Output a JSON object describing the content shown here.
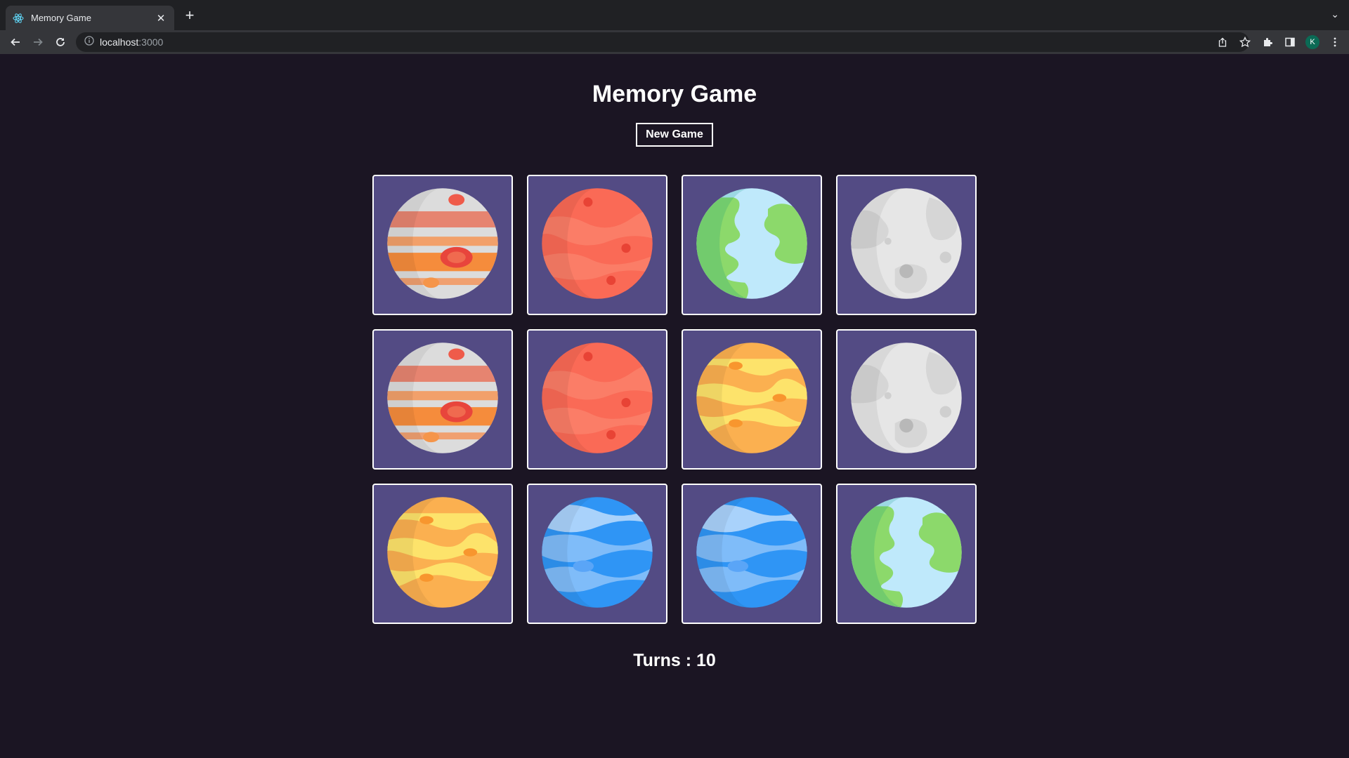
{
  "browser": {
    "tab_title": "Memory Game",
    "url_host": "localhost",
    "url_port": ":3000",
    "avatar_letter": "K"
  },
  "game": {
    "title": "Memory Game",
    "new_game_label": "New Game",
    "turns_label": "Turns : ",
    "turns": "10"
  },
  "cards": [
    {
      "planet": "jupiter"
    },
    {
      "planet": "mars"
    },
    {
      "planet": "earth"
    },
    {
      "planet": "moon"
    },
    {
      "planet": "jupiter"
    },
    {
      "planet": "mars"
    },
    {
      "planet": "venus"
    },
    {
      "planet": "moon"
    },
    {
      "planet": "venus"
    },
    {
      "planet": "neptune"
    },
    {
      "planet": "neptune"
    },
    {
      "planet": "earth"
    }
  ],
  "colors": {
    "page_bg": "#1b1523",
    "card_bg": "#534b84",
    "card_border": "#ffffff"
  }
}
